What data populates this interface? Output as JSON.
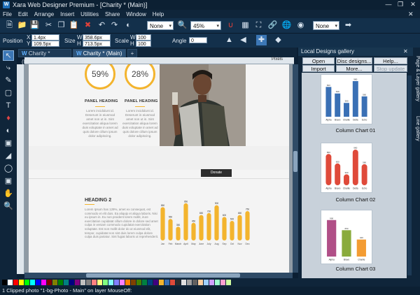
{
  "titlebar": {
    "app_icon": "W",
    "title": "Xara Web Designer Premium - [Charity * (Main)]"
  },
  "menu": [
    "File",
    "Edit",
    "Arrange",
    "Insert",
    "Utilities",
    "Share",
    "Window",
    "Help"
  ],
  "toolbar": {
    "none_combo": "None",
    "zoom_combo": "45%",
    "none_combo2": "None"
  },
  "infobar": {
    "position_label": "Position",
    "x_label": "X",
    "y_label": "Y",
    "x_value": "1.4px",
    "y_value": "109.5px",
    "size_label": "Size",
    "w_label": "W",
    "h_label": "H",
    "w_value": "358.6px",
    "h_value": "713.5px",
    "scale_label": "Scale",
    "sw_label": "W",
    "sh_label": "H",
    "scale_w": "100 %",
    "scale_h": "100 %",
    "angle_label": "Angle",
    "angle_value": "0"
  },
  "tabs": [
    {
      "label": "Charity * (Mobile)",
      "icon": "W"
    },
    {
      "label": "Charity * (Main)",
      "icon": "W"
    }
  ],
  "ruler": {
    "units": "Pixels"
  },
  "page": {
    "stat1": "59%",
    "stat2": "28%",
    "panel1_heading": "PANEL HEADING",
    "panel2_heading": "PANEL HEADING",
    "panel_text": "Lorem incididunt id. Deserunt in eiusmod amet non ut in. Sint exercitation aliqua lorem duis voluptate in amet ad quis dolore cillum ipsum dolor adipiscing.",
    "donate_button": "Donate",
    "heading2": "HEADING 2",
    "body_text": "Lorem Ipsum has 129%, amet ex consequat, est commodo et elit duis. Ea aliquip et aliqua laboris. Nisi eu ipsum in. Eu non proident lorem mollit, irure exercitation cupidatat cillum dolore in dolore sed amet culpa in veniam commodo cupidatat exercitation voluptate. Est non mollit dolor do ut eiusmod elit, tempor, cupidatat non sint duis lorem culpa dolore culpa duis pariatur. Sint fugiat laboris ut reprehenderit."
  },
  "chart_data": [
    {
      "type": "bar",
      "categories": [
        "Jan",
        "Feb",
        "March",
        "April",
        "May",
        "June",
        "July",
        "Aug",
        "Sep",
        "Oct",
        "Nov",
        "Dec"
      ],
      "values": [
        850,
        550,
        350,
        950,
        450,
        650,
        700,
        900,
        600,
        500,
        650,
        750
      ],
      "title": "",
      "ylim": [
        0,
        1000
      ]
    }
  ],
  "gallery": {
    "title": "Local Designs gallery",
    "buttons": [
      "Open",
      "Disc designs...",
      "Help...",
      "Import",
      "More...",
      "Stop update"
    ],
    "items": [
      {
        "label": "Column Chart 01",
        "color": "#3a70b5",
        "categories": [
          "Alpha",
          "Bravo",
          "Charlie",
          "Delta",
          "Echo"
        ],
        "values": [
          820,
          640,
          380,
          980,
          560
        ]
      },
      {
        "label": "Column Chart 02",
        "color": "#df4a3a",
        "categories": [
          "Alpha",
          "Bravo",
          "Charlie",
          "Delta",
          "Echo"
        ],
        "values": [
          860,
          600,
          300,
          980,
          580
        ]
      },
      {
        "label": "Column Chart 03",
        "colors": [
          "#b04f87",
          "#8aab3c",
          "#f39c33"
        ],
        "categories": [
          "Alpha",
          "Bravo",
          "Charlie"
        ],
        "values": [
          900,
          650,
          420
        ]
      }
    ]
  },
  "right_tabs": [
    "Page & Layer gallery",
    "Line gallery"
  ],
  "palette_colors": [
    "#000000",
    "#ffffff",
    "#ff0000",
    "#ffff00",
    "#00ff00",
    "#00ffff",
    "#0000ff",
    "#ff00ff",
    "#800000",
    "#808000",
    "#008000",
    "#008080",
    "#000080",
    "#800080",
    "#c0c0c0",
    "#808080",
    "#ff8080",
    "#ffff80",
    "#80ff80",
    "#80ffff",
    "#8080ff",
    "#ff80ff",
    "#ff8000",
    "#804000",
    "#408000",
    "#008040",
    "#004080",
    "#400080",
    "#f3b42e",
    "#3a70b5",
    "#df4a3a",
    "#2d2d2d",
    "#e0e0e0",
    "#a0a0a0",
    "#606060",
    "#ffd0a0",
    "#a0d0ff",
    "#d0a0ff",
    "#a0ffd0",
    "#ffa0d0",
    "#d0ffa0"
  ],
  "status": "1 Clipped photo \"1-bg-Photo - Main\" on layer MouseOff:"
}
